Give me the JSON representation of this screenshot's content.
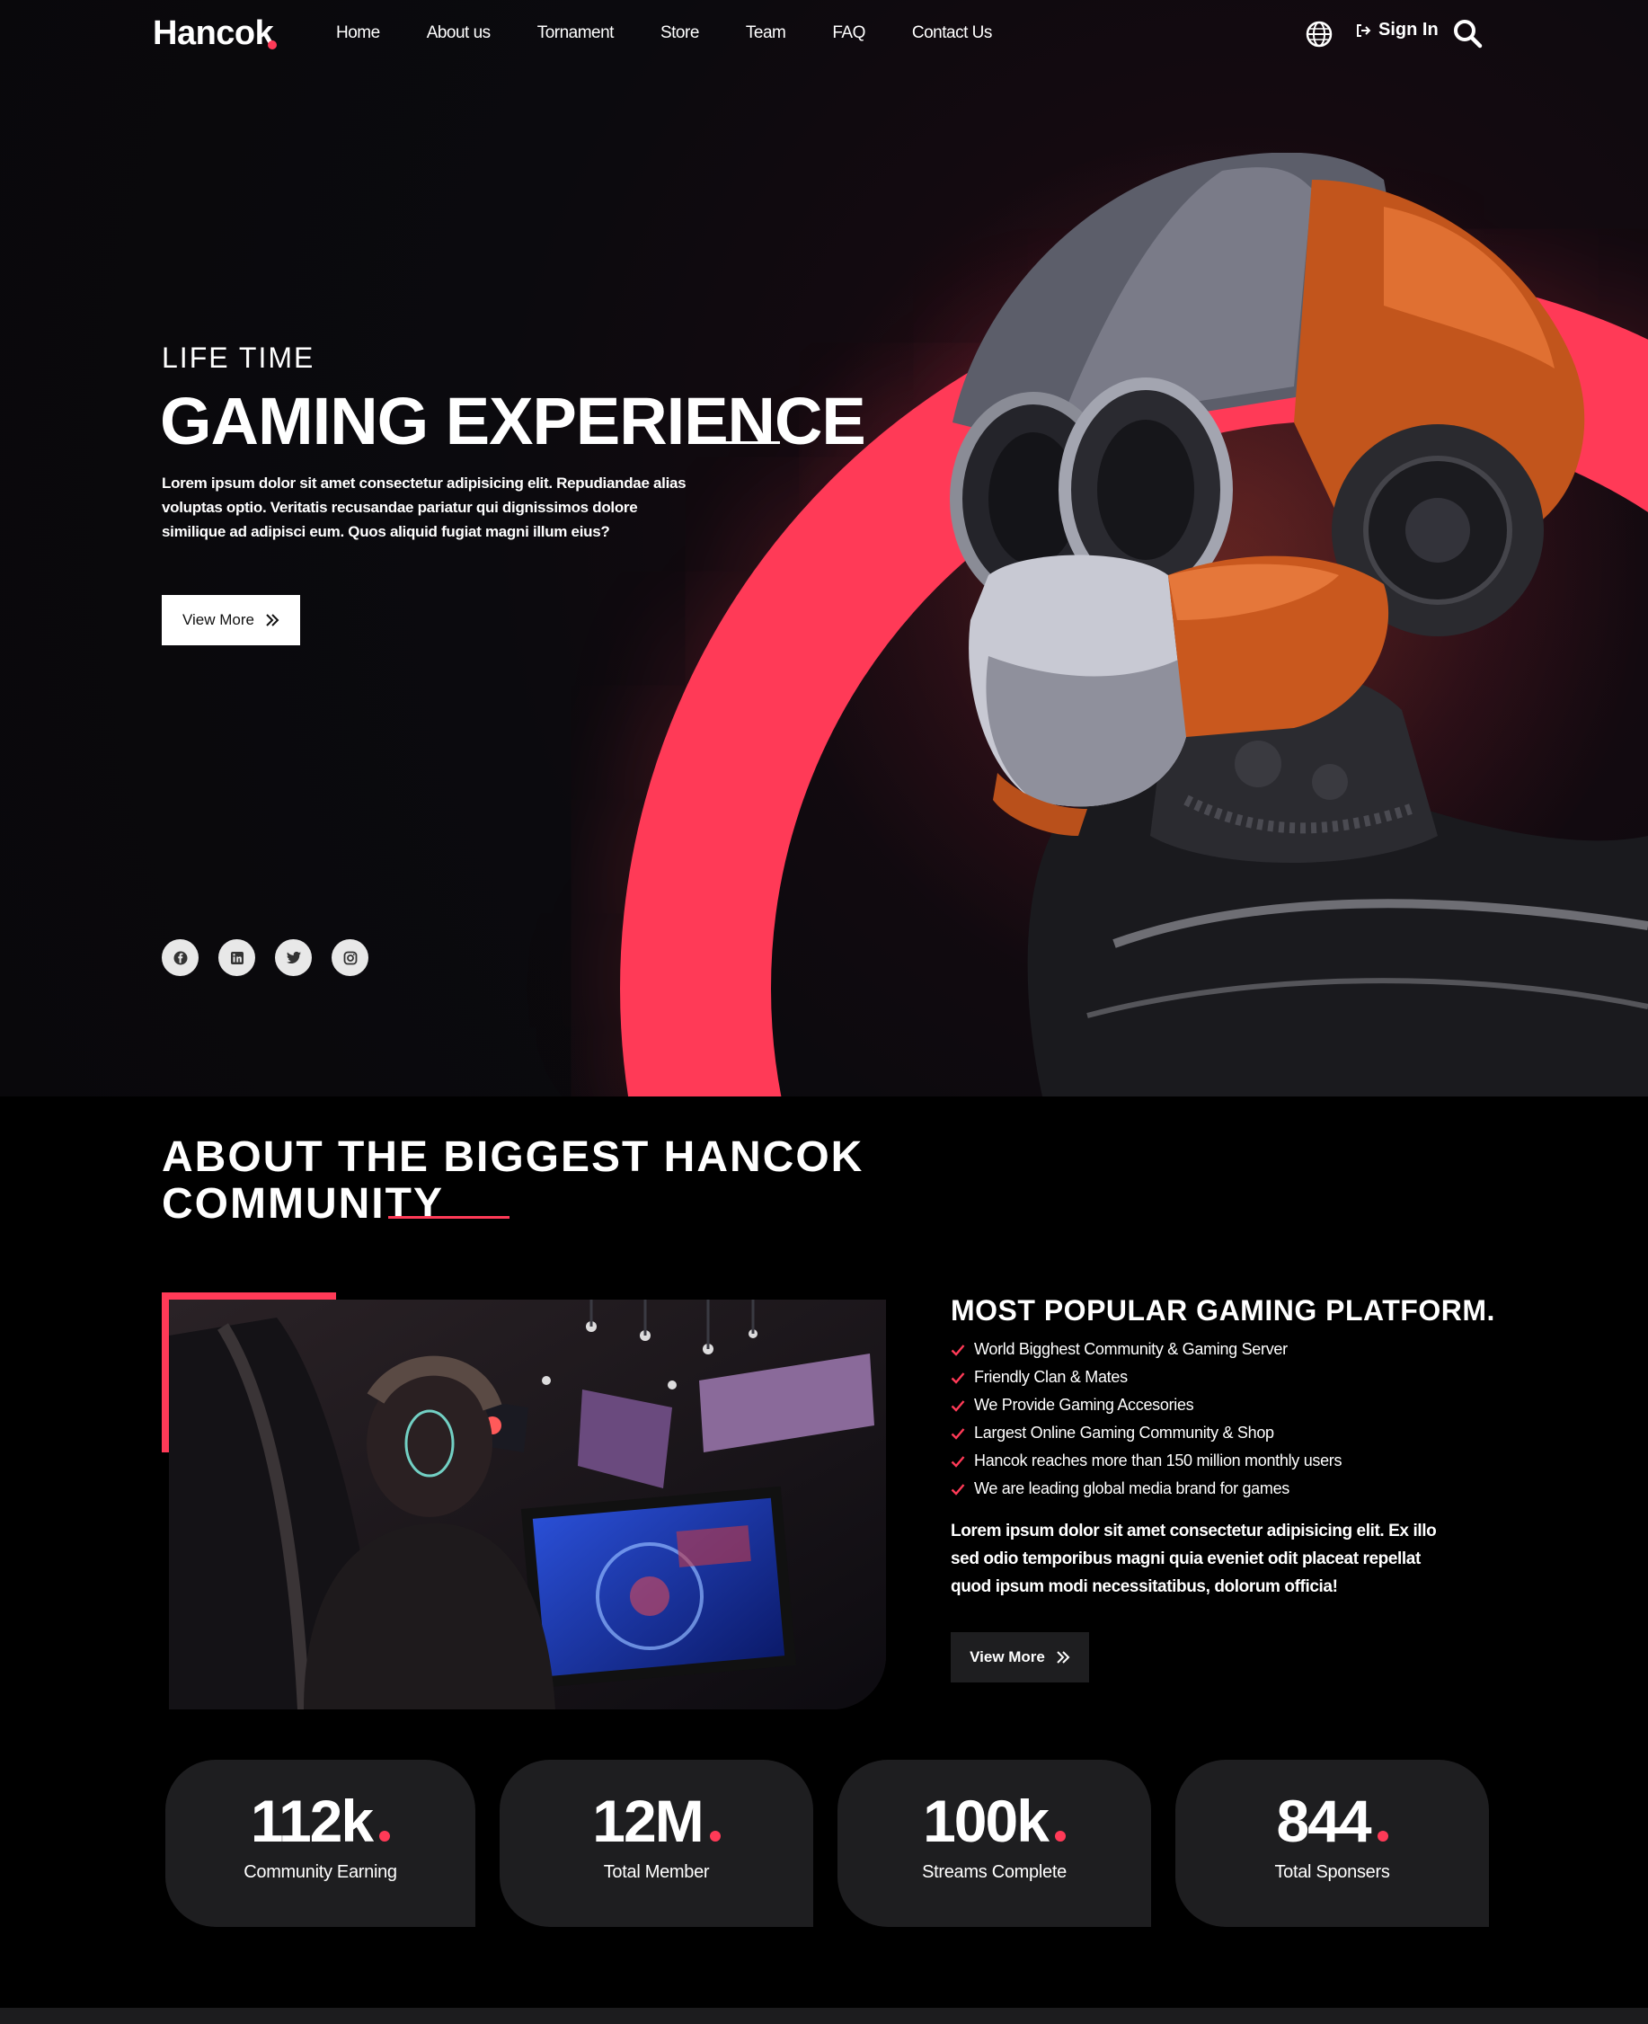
{
  "nav": {
    "logo": "Hancok",
    "menu": [
      "Home",
      "About us",
      "Tornament",
      "Store",
      "Team",
      "FAQ",
      "Contact Us"
    ],
    "signin_label": "Sign In",
    "icons": [
      "globe-icon",
      "sign-in-icon",
      "search-icon"
    ]
  },
  "hero": {
    "kicker": "LIFE TIME",
    "headline": "GAMING EXPERIENCE",
    "description": "Lorem ipsum dolor sit amet consectetur adipisicing elit. Repudiandae alias voluptas optio. Veritatis recusandae pariatur qui dignissimos dolore similique ad adipisci eum. Quos aliquid fugiat magni illum eius?",
    "button_label": "View More",
    "socials": [
      "facebook-icon",
      "linkedin-icon",
      "twitter-icon",
      "instagram-icon"
    ]
  },
  "about": {
    "title_line1": "ABOUT THE BIGGEST HANCOK",
    "title_line2": "COMMUNITY",
    "platform_title": "MOST POPULAR GAMING PLATFORM.",
    "features": [
      "World Bigghest Community & Gaming Server",
      "Friendly Clan & Mates",
      "We Provide Gaming Accesories",
      "Largest Online Gaming Community & Shop",
      "Hancok reaches more than 150 million monthly users",
      "We are leading global media brand for games"
    ],
    "description": "Lorem ipsum dolor sit amet consectetur adipisicing elit. Ex illo sed odio temporibus magni quia eveniet odit placeat repellat quod ipsum modi necessitatibus, dolorum officia!",
    "button_label": "View More"
  },
  "stats": [
    {
      "value": "112k",
      "label": "Community Earning"
    },
    {
      "value": "12M",
      "label": "Total Member"
    },
    {
      "value": "100k",
      "label": "Streams Complete"
    },
    {
      "value": "844",
      "label": "Total Sponsers"
    }
  ],
  "colors": {
    "accent": "#ff3a57",
    "background": "#000000",
    "card": "#1e1e20"
  }
}
